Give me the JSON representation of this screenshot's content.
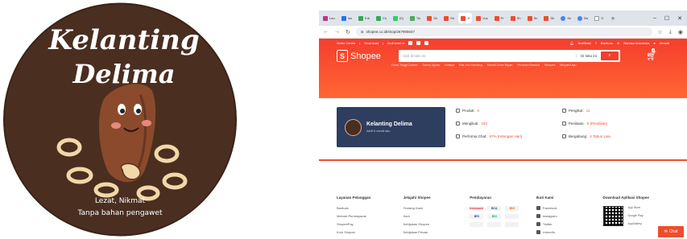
{
  "logo": {
    "title_line1": "Kelanting",
    "title_line2": "Delima",
    "tagline1": "Lezat, Nikmat",
    "tagline2": "Tanpa bahan pengawet",
    "colors": {
      "background": "#4a2e20",
      "accent": "#f2d7a9",
      "cheek": "#e58a7a"
    }
  },
  "browser": {
    "tabs": [
      {
        "label": "Lau",
        "color": "#c13584"
      },
      {
        "label": "Ins",
        "color": "#1877f2"
      },
      {
        "label": "Edi",
        "color": "#34a853"
      },
      {
        "label": "Ch",
        "color": "#34a853"
      },
      {
        "label": "(0)",
        "color": "#25d366"
      },
      {
        "label": "Tin",
        "color": "#4caf50"
      },
      {
        "label": "Sh",
        "color": "#ee4d2d"
      },
      {
        "label": "Sh",
        "color": "#ee4d2d"
      },
      {
        "label": "",
        "color": "#ee4d2d",
        "active": true
      },
      {
        "label": "Jus",
        "color": "#ee4d2d"
      },
      {
        "label": "Pr",
        "color": "#ee4d2d"
      },
      {
        "label": "Sh",
        "color": "#ee4d2d"
      },
      {
        "label": "Sh",
        "color": "#ee4d2d"
      },
      {
        "label": "Sh",
        "color": "#ee4d2d"
      },
      {
        "label": "Se",
        "color": "#4285f4"
      },
      {
        "label": "Ba",
        "color": "#4285f4"
      },
      {
        "label": "G",
        "color": "#ffffff"
      }
    ],
    "new_tab": "+",
    "window_controls": {
      "minimize": "–",
      "maximize": "☐",
      "close": "✕"
    },
    "url": "shopee.co.id/shop/267905047"
  },
  "shopee": {
    "nav_left": [
      "Seller Centre",
      "Download",
      "Ikuti kami di"
    ],
    "nav_right": [
      "Notifikasi",
      "Bantuan",
      "Bahasa Indonesia",
      "rhmadi"
    ],
    "brand": "Shopee",
    "search_placeholder": "Cari di toko ini",
    "search_scope": "Di toko ini",
    "cart_count": "0",
    "keywords": [
      "Gelas Tinggi Custom",
      "Sabun Jigsaw",
      "Kebaya",
      "Rak Jalu Sandang",
      "Sandal Cewe Bayan",
      "Penahan Rambut",
      "Skincare",
      "Minyak Kayu"
    ],
    "shop": {
      "name": "Kelanting Delima",
      "status": "Aktif 5 menit lalu",
      "stats_left": [
        {
          "label": "Produk:",
          "value": "0"
        },
        {
          "label": "Mengikuti:",
          "value": "184"
        },
        {
          "label": "Performa Chat:",
          "value": "57% (Hitungan Hari)"
        }
      ],
      "stats_right": [
        {
          "label": "Pengikut:",
          "value": "11"
        },
        {
          "label": "Penilaian:",
          "value": "0 (Penilaian)"
        },
        {
          "label": "Bergabung:",
          "value": "4 Tahun Lalu"
        }
      ]
    },
    "footer": {
      "cols": [
        {
          "title": "Layanan Pelanggan",
          "items": [
            "Bantuan",
            "Metode Pembayaran",
            "ShopeePay",
            "Koin Shopee"
          ]
        },
        {
          "title": "Jelajahi Shopee",
          "items": [
            "Tentang Kami",
            "Karir",
            "Kebijakan Shopee",
            "Kebijakan Privasi"
          ]
        }
      ],
      "payments_title": "Pembayaran",
      "payments": [
        "Indomaret",
        "BCA",
        "BNI",
        "BRI",
        "BSI",
        "",
        "",
        "",
        ""
      ],
      "follow_title": "Ikuti Kami",
      "follow": [
        "Facebook",
        "Instagram",
        "Twitter",
        "LinkedIn"
      ],
      "download_title": "Download Aplikasi Shopee",
      "stores": [
        "App Store",
        "Google Play",
        "AppGallery"
      ]
    },
    "chat": "Chat"
  }
}
